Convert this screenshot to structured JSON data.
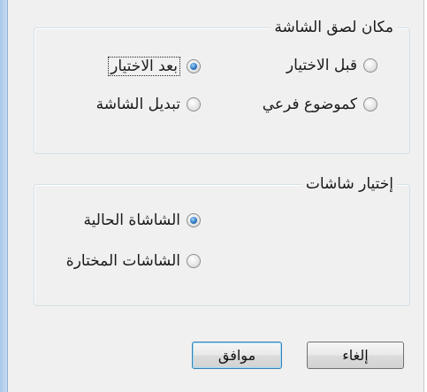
{
  "paste_location": {
    "legend": "مكان لصق الشاشة",
    "options": {
      "after_selection": "بعد الاختيار",
      "before_selection": "قبل الاختيار",
      "replace_screen": "تبديل الشاشة",
      "as_subtopic": "كموضوع فرعي"
    },
    "selected": "after_selection"
  },
  "select_screens": {
    "legend": "إختيار شاشات",
    "options": {
      "current_screen": "الشاشاة الحالية",
      "selected_screens": "الشاشات المختارة"
    },
    "selected": "current_screen"
  },
  "buttons": {
    "cancel_label": "إلغاء",
    "ok_label": "موافق"
  }
}
